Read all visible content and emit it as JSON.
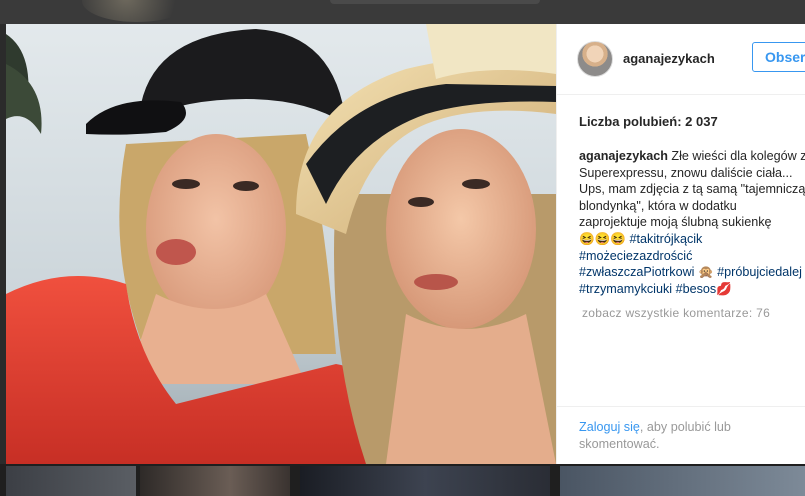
{
  "post": {
    "username": "aganajezykach",
    "follow_label": "Obserwuj",
    "likes_text": "Liczba polubień: 2 037",
    "caption": {
      "username": "aganajezykach",
      "lines": [
        " Złe wieści dla kolegów z",
        "Superexpressu, znowu daliście ciała...",
        "Ups, mam zdjęcia z tą samą \"tajemniczą",
        "blondynką\", która w dodatku",
        "zaprojektuje moją ślubną sukienkę"
      ],
      "emoji_line": "😆😆😆",
      "hashtags": {
        "h1": "#takitrójkącik",
        "h2": "#możeciezazdrościć",
        "h3": "#zwłaszczaPiotrkowi",
        "h3_emoji": "🙊",
        "h4": "#próbujciedalej",
        "h5": "#trzymamykciuki",
        "h6": "#besos",
        "h6_emoji": "💋"
      }
    },
    "view_all_comments": "zobacz wszystkie komentarze: 76",
    "footer": {
      "login_link": "Zaloguj się",
      "rest": ", aby polubić lub skomentować."
    }
  }
}
